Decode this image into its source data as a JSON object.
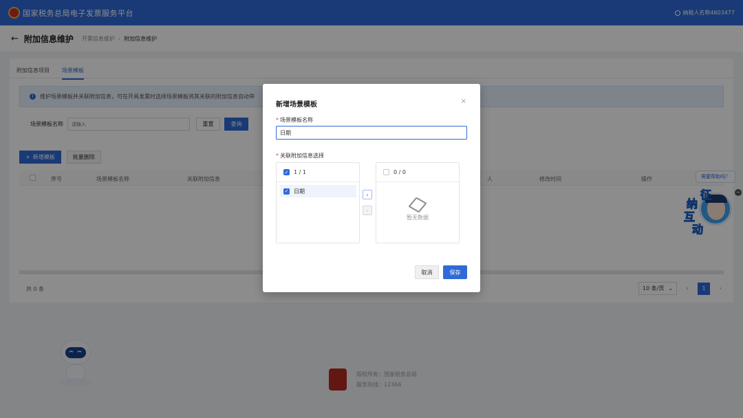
{
  "header": {
    "app_title": "国家税务总局电子发票服务平台",
    "user_label": "纳税人名称4603477"
  },
  "subheader": {
    "title": "附加信息维护",
    "breadcrumb": [
      "开票信息维护",
      "附加信息维护"
    ]
  },
  "tabs": [
    {
      "label": "附加信息项目",
      "active": false
    },
    {
      "label": "场景模板",
      "active": true
    }
  ],
  "alert": {
    "text": "维护场景模板并关联附加信息，可在开具发票时选择场景模板将其关联的附加信息自动带"
  },
  "search": {
    "label": "场景模板名称",
    "placeholder": "请输入",
    "reset_label": "重置",
    "query_label": "查询"
  },
  "actions": {
    "add_label": "新增模板",
    "batch_delete_label": "批量删除"
  },
  "table": {
    "columns": [
      "序号",
      "场景模板名称",
      "关联附加信息",
      "人",
      "修改时间",
      "操作"
    ]
  },
  "pagination": {
    "total": "共 0 条",
    "page_size": "10 条/页",
    "current_page": "1",
    "prev": "‹",
    "next": "›"
  },
  "footer": {
    "copyright": "版权所有：国家税务总局",
    "hotline": "服务热线：12366"
  },
  "help": {
    "bubble": "需要帮助吗？",
    "chars": [
      "征",
      "纳",
      "互",
      "动"
    ],
    "collapse": "−"
  },
  "modal": {
    "title": "新增场景模板",
    "close": "×",
    "name_label": "场景模板名称",
    "name_value": "日期",
    "link_label": "关联附加信息选择",
    "left_panel": {
      "count": "1 / 1",
      "items": [
        "日期"
      ]
    },
    "right_panel": {
      "count": "0 / 0",
      "empty_text": "暂无数据"
    },
    "move_right": "›",
    "move_left": "‹",
    "cancel_label": "取消",
    "save_label": "保存"
  },
  "colors": {
    "primary": "#2f6bd8",
    "header_bg": "#2f6bd8",
    "required": "#e5413b"
  }
}
